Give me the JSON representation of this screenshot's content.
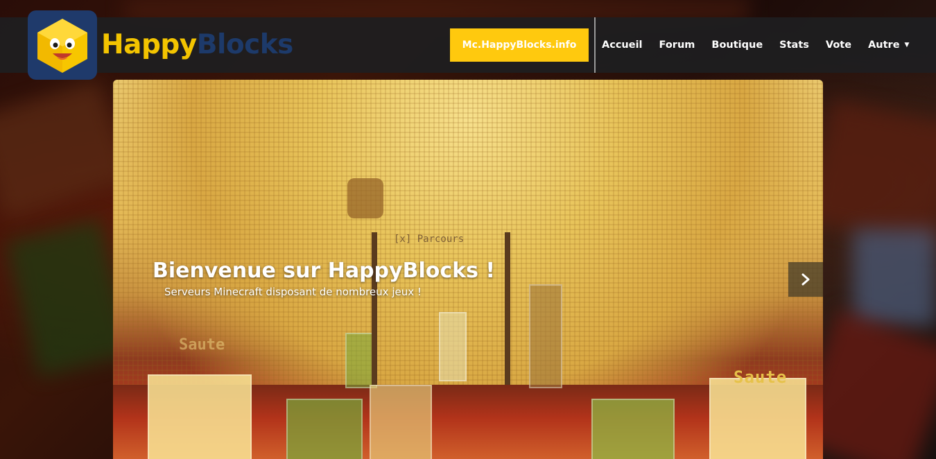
{
  "brand": {
    "name_part1": "Happy",
    "name_part2": "Blocks",
    "logo_icon": "happy-block-face-icon",
    "colors": {
      "yellow": "#f3c400",
      "navy": "#1d3a6a"
    }
  },
  "navbar": {
    "server_button_label": "Mc.HappyBlocks.info",
    "links": [
      {
        "label": "Accueil"
      },
      {
        "label": "Forum"
      },
      {
        "label": "Boutique"
      },
      {
        "label": "Stats"
      },
      {
        "label": "Vote"
      },
      {
        "label": "Autre",
        "has_dropdown": true
      }
    ],
    "colors": {
      "button_bg": "#ffc90e",
      "bar_bg": "#1e1e20"
    }
  },
  "carousel": {
    "title": "Bienvenue sur HappyBlocks !",
    "subtitle": "Serveurs Minecraft disposant de nombreux jeux !",
    "next_icon": "chevron-right-icon",
    "scene_text": [
      "Saute",
      "[x] Parcours"
    ]
  }
}
